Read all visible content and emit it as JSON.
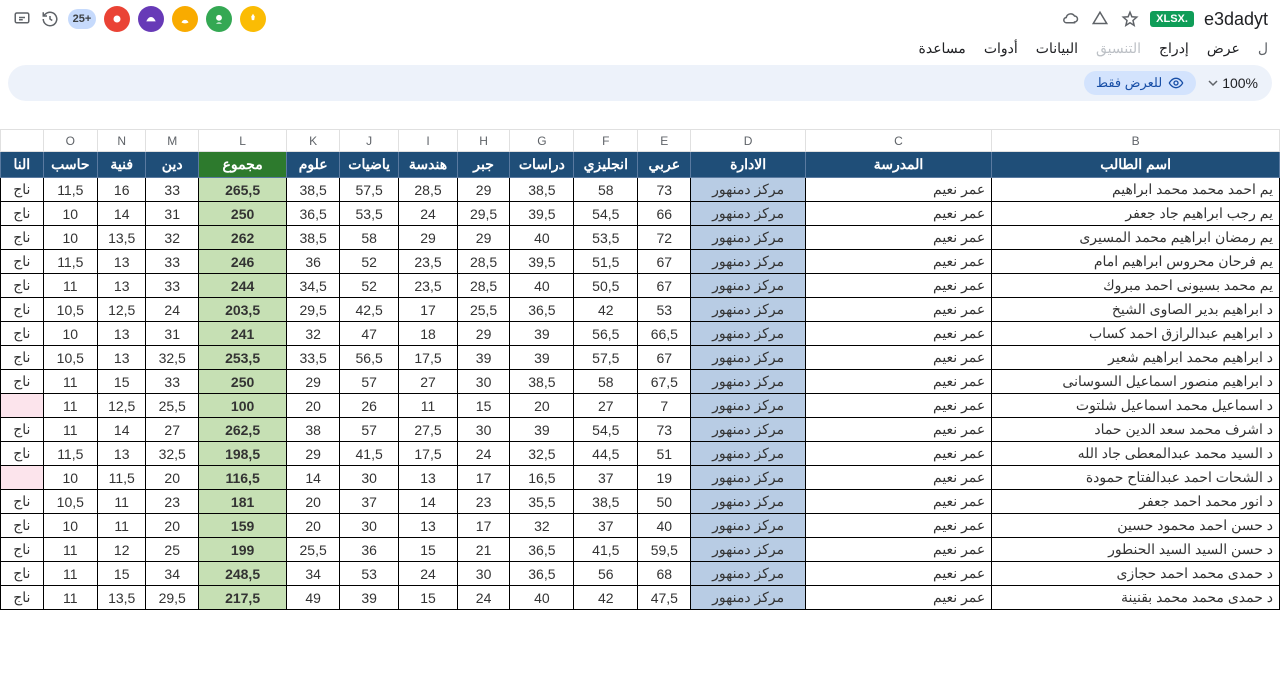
{
  "doc": {
    "filename": "e3dadyt",
    "badge": "XLSX."
  },
  "badges": {
    "count25": "25+"
  },
  "menus": {
    "view": "عرض",
    "insert": "إدراج",
    "data": "البيانات",
    "tools": "أدوات",
    "help": "مساعدة",
    "format": "التنسيق"
  },
  "toolbar": {
    "zoom": "100%",
    "viewonly": "للعرض فقط"
  },
  "colLetters": [
    "O",
    "N",
    "M",
    "L",
    "K",
    "J",
    "I",
    "H",
    "G",
    "F",
    "E",
    "D",
    "C",
    "B"
  ],
  "headers": {
    "B": "اسم الطالب",
    "C": "المدرسة",
    "D": "الادارة",
    "E": "عربي",
    "F": "انجليزي",
    "G": "دراسات",
    "H": "جبر",
    "I": "هندسة",
    "J": "ياضيات",
    "K": "علوم",
    "L": "مجموع",
    "M": "دين",
    "N": "فنية",
    "O": "حاسب",
    "P": "النا"
  },
  "rows": [
    {
      "B": "يم احمد محمد محمد ابراهيم",
      "C": "عمر نعيم",
      "D": "مركز دمنهور",
      "E": "73",
      "F": "58",
      "G": "38,5",
      "H": "29",
      "I": "28,5",
      "J": "57,5",
      "K": "38,5",
      "L": "265,5",
      "M": "33",
      "N": "16",
      "O": "11,5",
      "P": "ناج"
    },
    {
      "B": "يم رجب ابراهيم جاد جعفر",
      "C": "عمر نعيم",
      "D": "مركز دمنهور",
      "E": "66",
      "F": "54,5",
      "G": "39,5",
      "H": "29,5",
      "I": "24",
      "J": "53,5",
      "K": "36,5",
      "L": "250",
      "M": "31",
      "N": "14",
      "O": "10",
      "P": "ناج"
    },
    {
      "B": "يم رمضان ابراهيم محمد المسيرى",
      "C": "عمر نعيم",
      "D": "مركز دمنهور",
      "E": "72",
      "F": "53,5",
      "G": "40",
      "H": "29",
      "I": "29",
      "J": "58",
      "K": "38,5",
      "L": "262",
      "M": "32",
      "N": "13,5",
      "O": "10",
      "P": "ناج"
    },
    {
      "B": "يم فرحان محروس ابراهيم امام",
      "C": "عمر نعيم",
      "D": "مركز دمنهور",
      "E": "67",
      "F": "51,5",
      "G": "39,5",
      "H": "28,5",
      "I": "23,5",
      "J": "52",
      "K": "36",
      "L": "246",
      "M": "33",
      "N": "13",
      "O": "11,5",
      "P": "ناج"
    },
    {
      "B": "يم محمد بسيونى احمد مبروك",
      "C": "عمر نعيم",
      "D": "مركز دمنهور",
      "E": "67",
      "F": "50,5",
      "G": "40",
      "H": "28,5",
      "I": "23,5",
      "J": "52",
      "K": "34,5",
      "L": "244",
      "M": "33",
      "N": "13",
      "O": "11",
      "P": "ناج"
    },
    {
      "B": "د ابراهيم بدير الصاوى الشيخ",
      "C": "عمر نعيم",
      "D": "مركز دمنهور",
      "E": "53",
      "F": "42",
      "G": "36,5",
      "H": "25,5",
      "I": "17",
      "J": "42,5",
      "K": "29,5",
      "L": "203,5",
      "M": "24",
      "N": "12,5",
      "O": "10,5",
      "P": "ناج"
    },
    {
      "B": "د ابراهيم عبدالرازق احمد كساب",
      "C": "عمر نعيم",
      "D": "مركز دمنهور",
      "E": "66,5",
      "F": "56,5",
      "G": "39",
      "H": "29",
      "I": "18",
      "J": "47",
      "K": "32",
      "L": "241",
      "M": "31",
      "N": "13",
      "O": "10",
      "P": "ناج"
    },
    {
      "B": "د ابراهيم محمد ابراهيم شعير",
      "C": "عمر نعيم",
      "D": "مركز دمنهور",
      "E": "67",
      "F": "57,5",
      "G": "39",
      "H": "39",
      "I": "17,5",
      "J": "56,5",
      "K": "33,5",
      "L": "253,5",
      "M": "32,5",
      "N": "13",
      "O": "10,5",
      "P": "ناج"
    },
    {
      "B": "د ابراهيم منصور اسماعيل السوسانى",
      "C": "عمر نعيم",
      "D": "مركز دمنهور",
      "E": "67,5",
      "F": "58",
      "G": "38,5",
      "H": "30",
      "I": "27",
      "J": "57",
      "K": "29",
      "L": "250",
      "M": "33",
      "N": "15",
      "O": "11",
      "P": "ناج"
    },
    {
      "B": "د اسماعيل محمد اسماعيل شلتوت",
      "C": "عمر نعيم",
      "D": "مركز دمنهور",
      "E": "7",
      "F": "27",
      "G": "20",
      "H": "15",
      "I": "11",
      "J": "26",
      "K": "20",
      "L": "100",
      "M": "25,5",
      "N": "12,5",
      "O": "11",
      "P": "",
      "pink": true
    },
    {
      "B": "د اشرف محمد سعد الدين حماد",
      "C": "عمر نعيم",
      "D": "مركز دمنهور",
      "E": "73",
      "F": "54,5",
      "G": "39",
      "H": "30",
      "I": "27,5",
      "J": "57",
      "K": "38",
      "L": "262,5",
      "M": "27",
      "N": "14",
      "O": "11",
      "P": "ناج"
    },
    {
      "B": "د السيد محمد عبدالمعطى جاد الله",
      "C": "عمر نعيم",
      "D": "مركز دمنهور",
      "E": "51",
      "F": "44,5",
      "G": "32,5",
      "H": "24",
      "I": "17,5",
      "J": "41,5",
      "K": "29",
      "L": "198,5",
      "M": "32,5",
      "N": "13",
      "O": "11,5",
      "P": "ناج"
    },
    {
      "B": "د الشحات احمد عبدالفتاح حمودة",
      "C": "عمر نعيم",
      "D": "مركز دمنهور",
      "E": "19",
      "F": "37",
      "G": "16,5",
      "H": "17",
      "I": "13",
      "J": "30",
      "K": "14",
      "L": "116,5",
      "M": "20",
      "N": "11,5",
      "O": "10",
      "P": "",
      "pink": true
    },
    {
      "B": "د انور محمد احمد جعفر",
      "C": "عمر نعيم",
      "D": "مركز دمنهور",
      "E": "50",
      "F": "38,5",
      "G": "35,5",
      "H": "23",
      "I": "14",
      "J": "37",
      "K": "20",
      "L": "181",
      "M": "23",
      "N": "11",
      "O": "10,5",
      "P": "ناج"
    },
    {
      "B": "د حسن احمد محمود حسين",
      "C": "عمر نعيم",
      "D": "مركز دمنهور",
      "E": "40",
      "F": "37",
      "G": "32",
      "H": "17",
      "I": "13",
      "J": "30",
      "K": "20",
      "L": "159",
      "M": "20",
      "N": "11",
      "O": "10",
      "P": "ناج"
    },
    {
      "B": "د حسن السيد السيد الحنطور",
      "C": "عمر نعيم",
      "D": "مركز دمنهور",
      "E": "59,5",
      "F": "41,5",
      "G": "36,5",
      "H": "21",
      "I": "15",
      "J": "36",
      "K": "25,5",
      "L": "199",
      "M": "25",
      "N": "12",
      "O": "11",
      "P": "ناج"
    },
    {
      "B": "د حمدى محمد احمد حجازى",
      "C": "عمر نعيم",
      "D": "مركز دمنهور",
      "E": "68",
      "F": "56",
      "G": "36,5",
      "H": "30",
      "I": "24",
      "J": "53",
      "K": "34",
      "L": "248,5",
      "M": "34",
      "N": "15",
      "O": "11",
      "P": "ناج"
    },
    {
      "B": "د حمدى محمد محمد بقنينة",
      "C": "عمر نعيم",
      "D": "مركز دمنهور",
      "E": "47,5",
      "F": "42",
      "G": "40",
      "H": "24",
      "I": "15",
      "J": "39",
      "K": "49",
      "L": "217,5",
      "M": "29,5",
      "N": "13,5",
      "O": "11",
      "P": "ناج"
    }
  ]
}
